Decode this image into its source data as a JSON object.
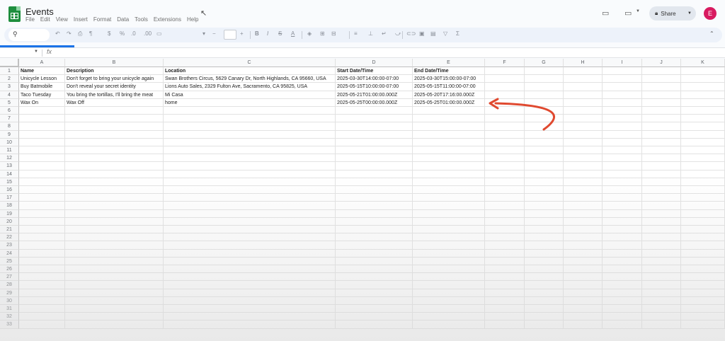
{
  "window": {
    "title": "Events",
    "menu": [
      "File",
      "Edit",
      "View",
      "Insert",
      "Format",
      "Data",
      "Tools",
      "Extensions",
      "Help"
    ],
    "share_label": "Share",
    "avatar_initial": "E"
  },
  "toolbar": {
    "search_icon": "🔍"
  },
  "formula_bar": {
    "fx": "fx"
  },
  "grid": {
    "columns": [
      "A",
      "B",
      "C",
      "D",
      "E",
      "F",
      "G",
      "H",
      "I",
      "J",
      "K"
    ],
    "row_numbers": [
      "1",
      "2",
      "3",
      "4",
      "5",
      "6",
      "7",
      "8",
      "9",
      "10",
      "11",
      "12",
      "13",
      "14",
      "15",
      "16",
      "17",
      "18",
      "19",
      "20",
      "21",
      "22",
      "23",
      "24",
      "25",
      "26",
      "27",
      "28",
      "29",
      "30",
      "31",
      "32",
      "33"
    ],
    "headers": [
      "Name",
      "Description",
      "Location",
      "Start Date/Time",
      "End Date/Time"
    ],
    "rows": [
      [
        "Unicycle Lesson",
        "Don't forget to bring your unicycle again",
        "Swan Brothers Circus, 5629 Canary Dr, North Highlands, CA 95660, USA",
        "2025-03-30T14:00:00-07:00",
        "2025-03-30T15:00:00-07:00"
      ],
      [
        "Buy Batmobile",
        "Don't reveal your secret identity",
        "Lions Auto Sales, 2329 Fulton Ave, Sacramento, CA 95825, USA",
        "2025-05-15T10:00:00-07:00",
        "2025-05-15T11:00:00-07:00"
      ],
      [
        "Taco Tuesday",
        "You bring the tortillas, I'll bring the meat",
        "Mi Casa",
        "2025-05-21T01:00:00.000Z",
        "2025-05-20T17:16:00.000Z"
      ],
      [
        "Wax On",
        "Wax Off",
        "home",
        "2025-05-25T00:00:00.000Z",
        "2025-05-25T01:00:00.000Z"
      ]
    ]
  },
  "annotation": {
    "arrow_color": "#e0492f"
  }
}
